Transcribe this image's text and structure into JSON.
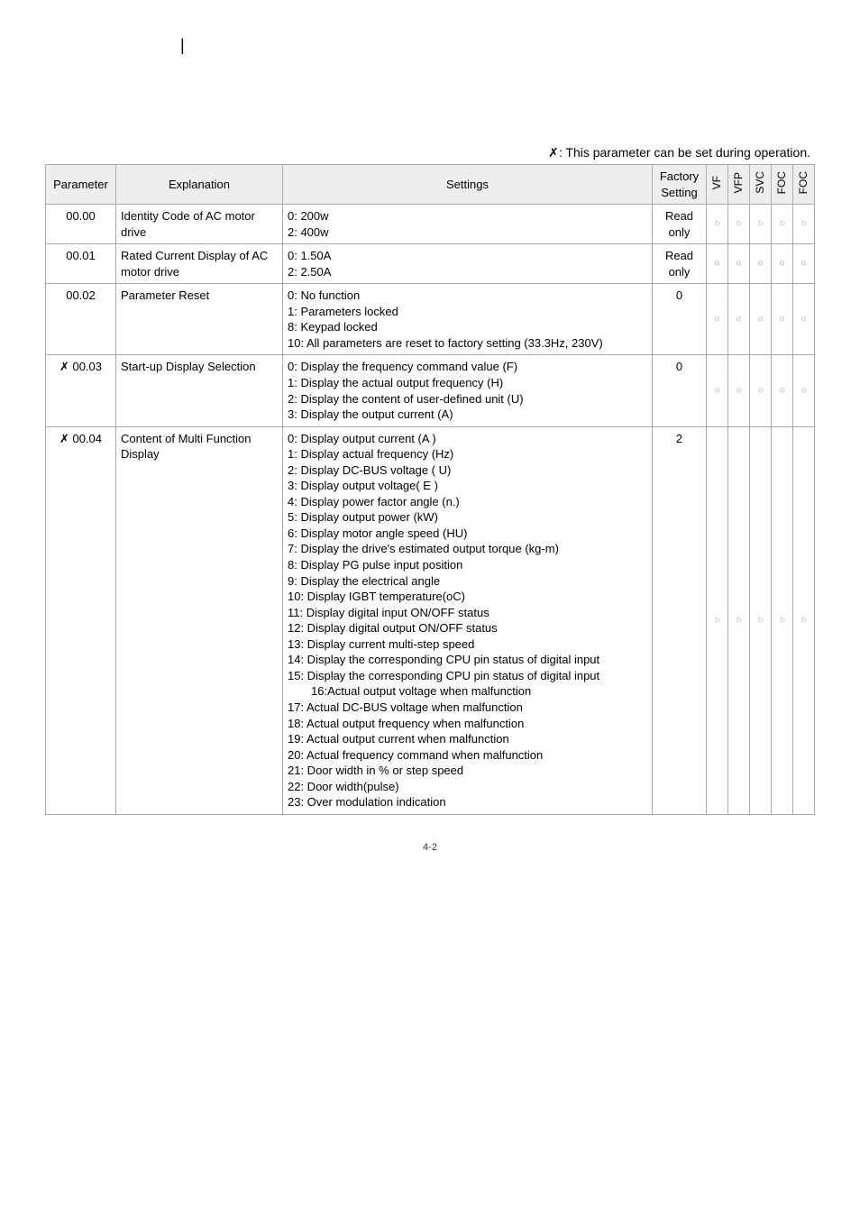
{
  "note": "�ках: This parameter can be set during operation.",
  "note_symbol": "✗",
  "note_text": ": This parameter can be set during operation.",
  "headers": {
    "parameter": "Parameter",
    "explanation": "Explanation",
    "settings": "Settings",
    "factory": "Factory Setting",
    "flags": [
      "VF",
      "VFP",
      "SVC",
      "FOC",
      "FOC"
    ]
  },
  "rows": [
    {
      "param": "00.00",
      "explanation": "Identity Code of AC motor drive",
      "settings": [
        "0: 200w",
        "2: 400w"
      ],
      "factory": "Read only",
      "flags": [
        "○",
        "○",
        "○",
        "○",
        "○"
      ]
    },
    {
      "param": "00.01",
      "explanation": "Rated Current Display of AC motor drive",
      "settings": [
        "0: 1.50A",
        "2: 2.50A"
      ],
      "factory": "Read only",
      "flags": [
        "○",
        "○",
        "○",
        "○",
        "○"
      ]
    },
    {
      "param": "00.02",
      "explanation": "Parameter Reset",
      "settings": [
        "0: No function",
        "1: Parameters locked",
        "8: Keypad locked",
        "10: All parameters are reset to factory setting (33.3Hz, 230V)"
      ],
      "factory": "0",
      "flags": [
        "○",
        "○",
        "○",
        "○",
        "○"
      ]
    },
    {
      "param": "✗ 00.03",
      "explanation": "Start-up Display Selection",
      "settings": [
        "0: Display the frequency command value (F)",
        "1: Display the actual output frequency (H)",
        "2: Display the content of user-defined unit (U)",
        "3: Display the output current (A)"
      ],
      "factory": "0",
      "flags": [
        "○",
        "○",
        "○",
        "○",
        "○"
      ]
    },
    {
      "param": "✗ 00.04",
      "explanation": "Content of Multi Function Display",
      "settings": [
        "0: Display output current (A )",
        "1: Display actual frequency (Hz)",
        "2: Display DC-BUS voltage ( U)",
        "3: Display output voltage( E )",
        "4: Display power factor angle (n.)",
        "5: Display output power (kW)",
        "6: Display motor angle speed (HU)",
        "7: Display the drive's estimated output torque (kg-m)",
        "8: Display PG pulse input position",
        "9: Display the electrical angle",
        "10: Display IGBT temperature(oC)",
        "11: Display digital input ON/OFF status",
        "12: Display digital output ON/OFF status",
        "13: Display current multi-step speed",
        "14: Display the corresponding CPU pin status of digital input",
        "15: Display the corresponding CPU pin status of digital input 16:Actual output voltage when malfunction",
        "17: Actual DC-BUS voltage when malfunction",
        "18: Actual output frequency when malfunction",
        "19: Actual output current when malfunction",
        "20: Actual frequency command when malfunction",
        "21: Door width in % or step speed",
        "22: Door width(pulse)",
        "23: Over modulation indication"
      ],
      "factory": "2",
      "flags": [
        "○",
        "○",
        "○",
        "○",
        "○"
      ]
    }
  ],
  "page_number": "4-2"
}
